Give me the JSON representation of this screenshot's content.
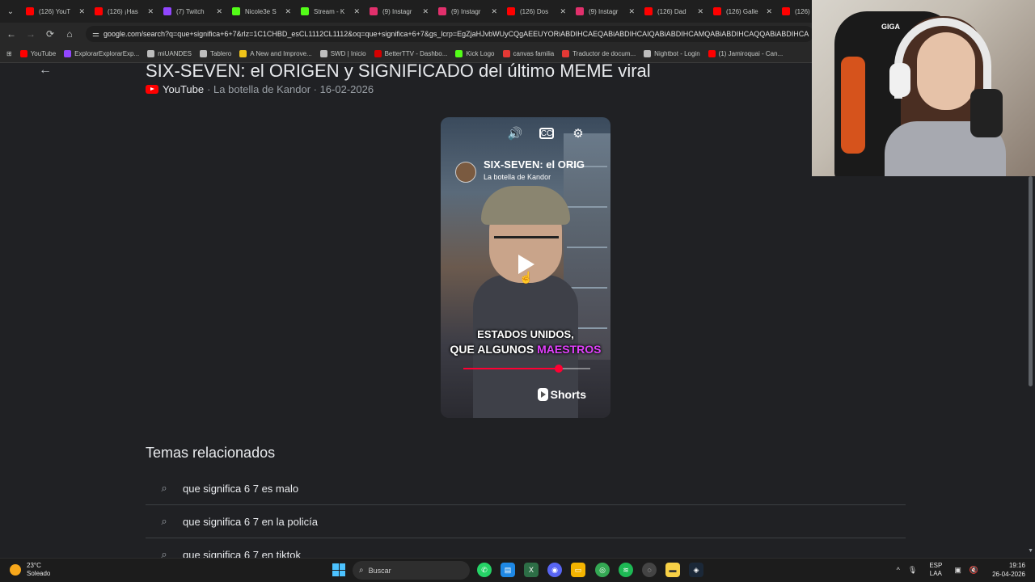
{
  "browser": {
    "tabs": [
      {
        "title": "(126) YouT",
        "color": "#ff0000"
      },
      {
        "title": "(126) ¡Has",
        "color": "#ff0000"
      },
      {
        "title": "(7) Twitch",
        "color": "#9146ff"
      },
      {
        "title": "Nicole3e S",
        "color": "#53fc18"
      },
      {
        "title": "Stream - K",
        "color": "#53fc18"
      },
      {
        "title": "(9) Instagr",
        "color": "#e1306c"
      },
      {
        "title": "(9) Instagr",
        "color": "#e1306c"
      },
      {
        "title": "(126) Dos",
        "color": "#ff0000"
      },
      {
        "title": "(9) Instagr",
        "color": "#e1306c"
      },
      {
        "title": "(126) Dad",
        "color": "#ff0000"
      },
      {
        "title": "(126) Galle",
        "color": "#ff0000"
      },
      {
        "title": "(126)",
        "color": "#ff0000"
      }
    ],
    "url": "google.com/search?q=que+significa+6+7&rlz=1C1CHBD_esCL1112CL1112&oq=que+significa+6+7&gs_lcrp=EgZjaHJvbWUyCQgAEEUYORiABDIHCAEQABiABDIHCAIQABiABDIHCAMQABiABDIHCAQQABiABDIHCA",
    "bookmarks": [
      {
        "label": "YouTube",
        "color": "#ff0000"
      },
      {
        "label": "ExplorarExplorarExp...",
        "color": "#9146ff"
      },
      {
        "label": "miUANDES",
        "color": "#bdbdbd"
      },
      {
        "label": "Tablero",
        "color": "#bdbdbd"
      },
      {
        "label": "A New and Improve...",
        "color": "#f0c419"
      },
      {
        "label": "SWD | Inicio",
        "color": "#bdbdbd"
      },
      {
        "label": "BetterTTV - Dashbo...",
        "color": "#d50000"
      },
      {
        "label": "Kick Logo",
        "color": "#53fc18"
      },
      {
        "label": "canvas familia",
        "color": "#e53935"
      },
      {
        "label": "Traductor de docum...",
        "color": "#e53935"
      },
      {
        "label": "Nightbot - Login",
        "color": "#bdbdbd"
      },
      {
        "label": "(1) Jamiroquai - Can...",
        "color": "#ff0000"
      }
    ]
  },
  "result": {
    "title": "SIX-SEVEN: el ORIGEN y SIGNIFICADO del último MEME viral",
    "source": "YouTube",
    "meta": "· La botella de Kandor · 16-02-2026"
  },
  "video": {
    "title": "SIX-SEVEN: el ORIG",
    "channel": "La botella de Kandor",
    "caption_line1": "ESTADOS UNIDOS,",
    "caption_line2_a": "QUE ALGUNOS ",
    "caption_line2_b": "MAESTROS",
    "shorts_label": "Shorts",
    "progress": 0.75
  },
  "related": {
    "heading": "Temas relacionados",
    "items": [
      "que significa 6 7 es malo",
      "que significa 6 7 en la policía",
      "que significa 6 7 en tiktok"
    ]
  },
  "webcam": {
    "chair_label": "GIGA"
  },
  "taskbar": {
    "weather_temp": "23°C",
    "weather_desc": "Soleado",
    "search_placeholder": "Buscar",
    "lang_top": "ESP",
    "lang_bottom": "LAA",
    "time": "19:16",
    "date": "26-04-2026"
  }
}
